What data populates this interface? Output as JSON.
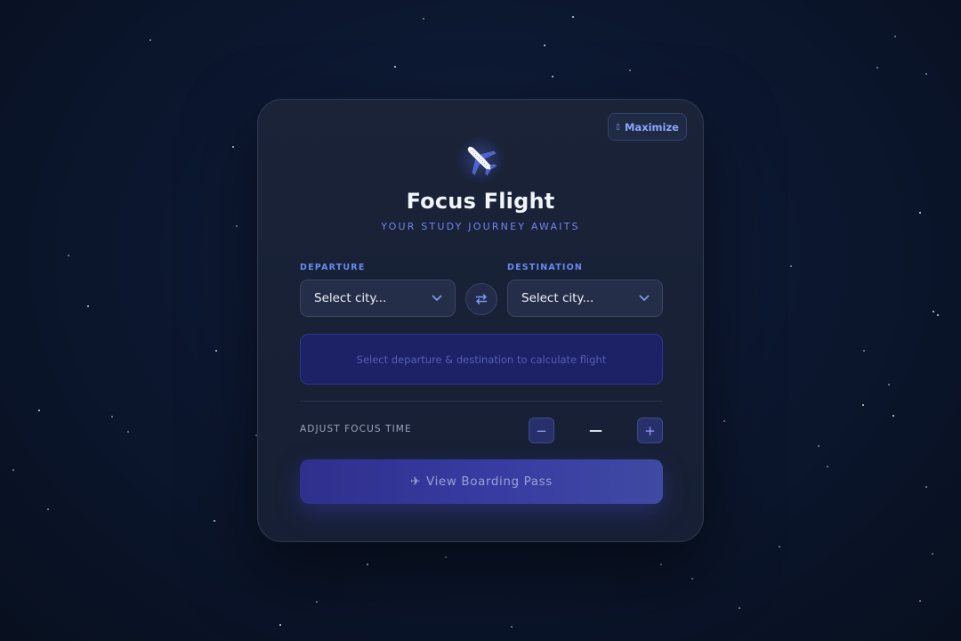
{
  "card": {
    "maximize_label": "Maximize",
    "maximize_icon": "maximize-icon",
    "logo_icon": "airplane-icon",
    "title": "Focus Flight",
    "subtitle": "YOUR STUDY JOURNEY AWAITS"
  },
  "route": {
    "departure_label": "DEPARTURE",
    "departure_value": "Select city...",
    "destination_label": "DESTINATION",
    "destination_value": "Select city...",
    "swap_icon": "swap-arrows-icon"
  },
  "flight_info": "Select departure & destination to calculate flight",
  "focus": {
    "label": "ADJUST FOCUS TIME",
    "decrement": "−",
    "value": "—",
    "increment": "+"
  },
  "boarding": {
    "icon": "✈",
    "label": "View Boarding Pass"
  },
  "colors": {
    "accent": "#6f86f0",
    "card_bg": "#1a2338",
    "button_gradient_start": "#2f2f8c",
    "button_gradient_end": "#3f4aa3"
  }
}
